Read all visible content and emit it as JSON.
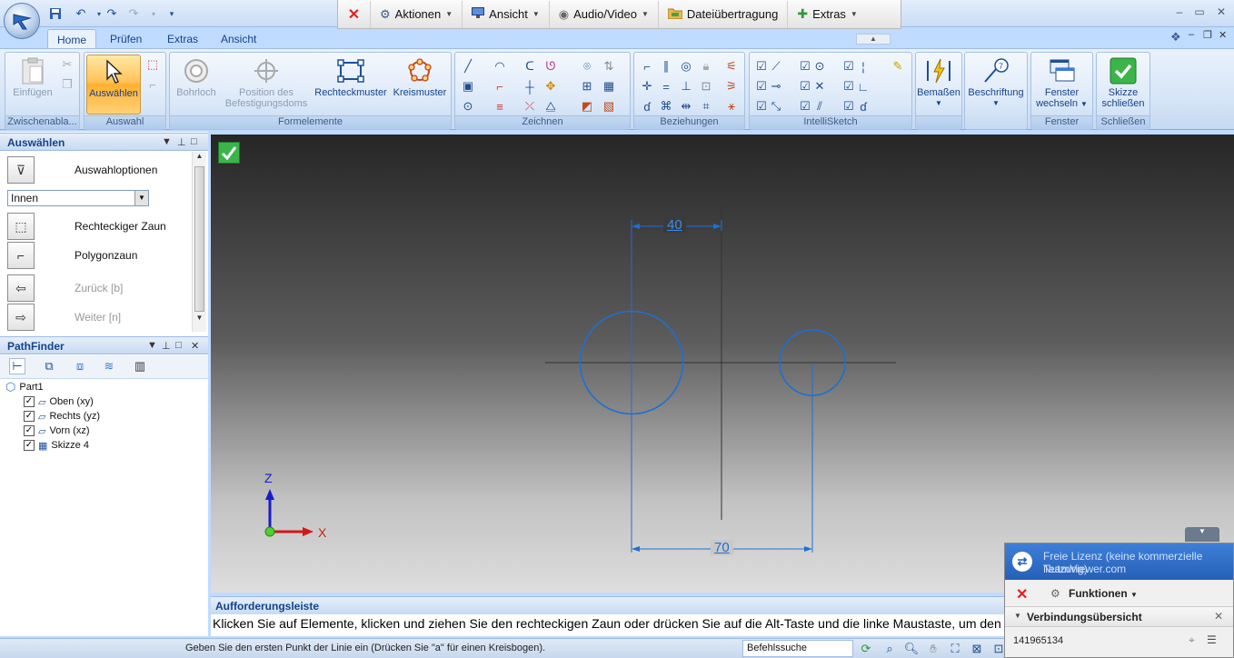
{
  "colors": {
    "accent": "#15428b",
    "sketch_blue": "#1f6fd1",
    "ribbon_bg": "#d3e3f7",
    "selected": "#ffc35a"
  },
  "qat": {
    "icons": [
      "save-icon",
      "undo-icon",
      "redo-icon"
    ]
  },
  "teamviewer_bar": {
    "close_icon": "close-icon",
    "items": [
      {
        "label": "Aktionen",
        "icon": "gear-icon"
      },
      {
        "label": "Ansicht",
        "icon": "monitor-icon"
      },
      {
        "label": "Audio/Video",
        "icon": "webcam-icon"
      },
      {
        "label": "Dateiübertragung",
        "icon": "folder-icon"
      },
      {
        "label": "Extras",
        "icon": "puzzle-icon"
      }
    ]
  },
  "tabs": [
    "Home",
    "Prüfen",
    "Extras",
    "Ansicht"
  ],
  "ribbon": {
    "groups": {
      "clipboard": "Zwischenabla...",
      "select": "Auswahl",
      "features": "Formelemente",
      "draw": "Zeichnen",
      "relations": "Beziehungen",
      "intellisketch": "IntelliSketch",
      "dimension": "",
      "window": "Fenster",
      "close": "Schließen"
    },
    "buttons": {
      "paste": "Einfügen",
      "select": "Auswählen",
      "hole": "Bohrloch",
      "boss_pos_1": "Position des",
      "boss_pos_2": "Befestigungsdoms",
      "rect_pattern": "Rechteckmuster",
      "circ_pattern": "Kreismuster",
      "dimension": "Bemaßen",
      "annotation": "Beschriftung",
      "switch_window_1": "Fenster",
      "switch_window_2": "wechseln",
      "close_sketch_1": "Skizze",
      "close_sketch_2": "schließen"
    }
  },
  "select_panel": {
    "title": "Auswählen",
    "options_label": "Auswahloptionen",
    "dropdown_value": "Innen",
    "rect_fence": "Rechteckiger Zaun",
    "poly_fence": "Polygonzaun",
    "back": "Zurück [b]",
    "next": "Weiter [n]"
  },
  "pathfinder": {
    "title": "PathFinder",
    "root": "Part1",
    "items": [
      {
        "label": "Oben (xy)",
        "checked": true
      },
      {
        "label": "Rechts (yz)",
        "checked": true
      },
      {
        "label": "Vorn (xz)",
        "checked": true
      },
      {
        "label": "Skizze 4",
        "checked": true
      }
    ]
  },
  "viewport": {
    "dim_top": "40",
    "dim_bottom": "70",
    "axis_z": "Z",
    "axis_x": "X"
  },
  "prompt": {
    "title": "Aufforderungsleiste",
    "text": "Klicken Sie auf Elemente, klicken und ziehen Sie den rechteckigen Zaun oder drücken Sie auf die Alt-Taste und die linke Maustaste, um den ersten"
  },
  "status": {
    "text": "Geben Sie den ersten Punkt der Linie ein (Drücken Sie \"a\" für einen Kreisbogen).",
    "command_search": "Befehlssuche"
  },
  "teamviewer_panel": {
    "license": "Freie Lizenz (keine kommerzielle Nutzung)",
    "site": "TeamViewer.com",
    "functions": "Funktionen",
    "overview": "Verbindungsübersicht",
    "id": "141965134"
  }
}
